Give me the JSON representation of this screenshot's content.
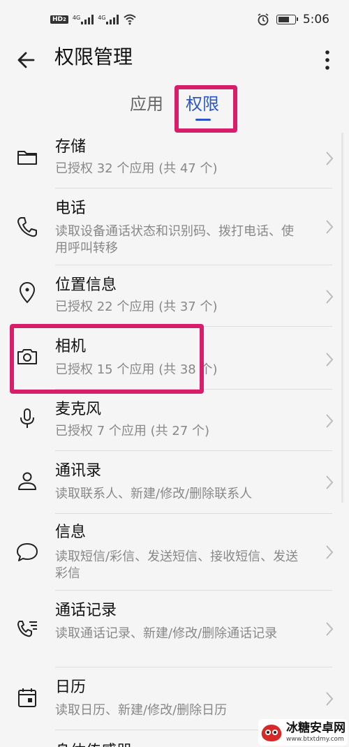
{
  "status_bar": {
    "hd": "HD",
    "hd_sub": "2",
    "signal_1": "4G",
    "signal_2": "4G",
    "time": "5:06"
  },
  "header": {
    "title": "权限管理"
  },
  "tabs": [
    {
      "label": "应用",
      "active": false
    },
    {
      "label": "权限",
      "active": true
    }
  ],
  "permissions": [
    {
      "title": "存储",
      "subtitle": "已授权 32 个应用 (共 47 个)",
      "icon": "folder-icon"
    },
    {
      "title": "电话",
      "subtitle": "读取设备通话状态和识别码、拨打电话、使用呼叫转移",
      "icon": "phone-icon"
    },
    {
      "title": "位置信息",
      "subtitle": "已授权 22 个应用 (共 37 个)",
      "icon": "location-icon"
    },
    {
      "title": "相机",
      "subtitle": "已授权 15 个应用 (共 38 个)",
      "icon": "camera-icon"
    },
    {
      "title": "麦克风",
      "subtitle": "已授权 7 个应用 (共 27 个)",
      "icon": "microphone-icon"
    },
    {
      "title": "通讯录",
      "subtitle": "读取联系人、新建/修改/删除联系人",
      "icon": "contacts-icon"
    },
    {
      "title": "信息",
      "subtitle": "读取短信/彩信、发送短信、接收短信、发送彩信",
      "icon": "message-icon"
    },
    {
      "title": "通话记录",
      "subtitle": "读取通话记录、新建/修改/删除通话记录",
      "icon": "call-log-icon"
    },
    {
      "title": "日历",
      "subtitle": "读取日历、新建/修改/删除日历",
      "icon": "calendar-icon"
    },
    {
      "title": "身体传感器",
      "subtitle": "",
      "icon": "body-sensor-icon"
    }
  ],
  "watermark": {
    "name": "冰糖安卓网",
    "url": "www.btxtdmy.com"
  },
  "colors": {
    "accent": "#2b57c8",
    "highlight": "#d81e6a"
  }
}
